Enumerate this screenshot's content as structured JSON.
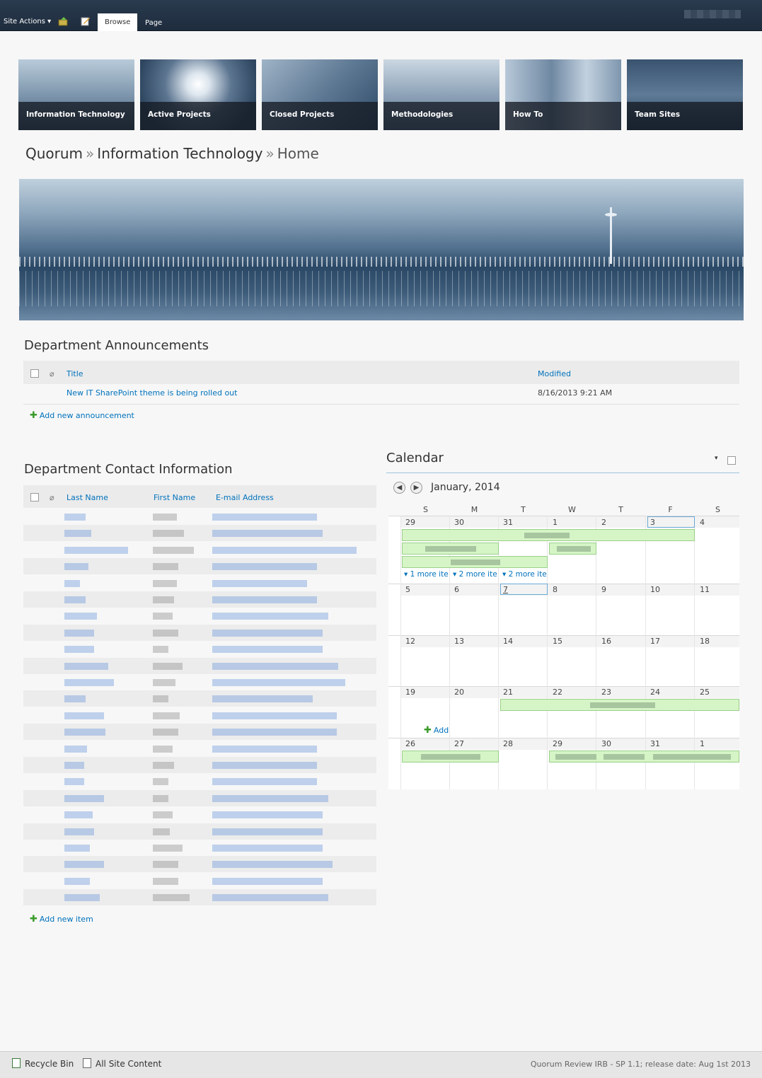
{
  "ribbon": {
    "site_actions": "Site Actions ▾",
    "tabs": [
      "Browse",
      "Page"
    ]
  },
  "nav_tiles": [
    {
      "label": "Information Technology"
    },
    {
      "label": "Active Projects"
    },
    {
      "label": "Closed Projects"
    },
    {
      "label": "Methodologies"
    },
    {
      "label": "How To"
    },
    {
      "label": "Team Sites"
    }
  ],
  "breadcrumb": {
    "parts": [
      "Quorum",
      "Information Technology",
      "Home"
    ],
    "separator": "»"
  },
  "announcements": {
    "title": "Department Announcements",
    "col_title": "Title",
    "col_modified": "Modified",
    "rows": [
      {
        "title": "New IT SharePoint theme is being rolled out",
        "modified": "8/16/2013 9:21 AM"
      }
    ],
    "add_label": "Add new announcement"
  },
  "contacts": {
    "title": "Department Contact Information",
    "columns": [
      "Last Name",
      "First Name",
      "E-mail Address"
    ],
    "add_label": "Add new item"
  },
  "calendar": {
    "title": "Calendar",
    "dropdown": "▾",
    "month": "January, 2014",
    "weekdays": [
      "S",
      "M",
      "T",
      "W",
      "T",
      "F",
      "S"
    ],
    "weeks": [
      [
        "29",
        "30",
        "31",
        "1",
        "2",
        "3",
        "4"
      ],
      [
        "5",
        "6",
        "7",
        "8",
        "9",
        "10",
        "11"
      ],
      [
        "12",
        "13",
        "14",
        "15",
        "16",
        "17",
        "18"
      ],
      [
        "19",
        "20",
        "21",
        "22",
        "23",
        "24",
        "25"
      ],
      [
        "26",
        "27",
        "28",
        "29",
        "30",
        "31",
        "1"
      ]
    ],
    "more_items": [
      "▾ 1 more ite",
      "▾ 2 more ite",
      "▾ 2 more ite"
    ],
    "add_label": "Add"
  },
  "footer": {
    "recycle_bin": "Recycle Bin",
    "all_site_content": "All Site Content",
    "release": "Quorum Review IRB - SP 1.1; release date: Aug 1st 2013"
  },
  "colors": {
    "ribbon": "#1e2c3d",
    "link": "#0072bc",
    "event": "#d6f5c6"
  }
}
